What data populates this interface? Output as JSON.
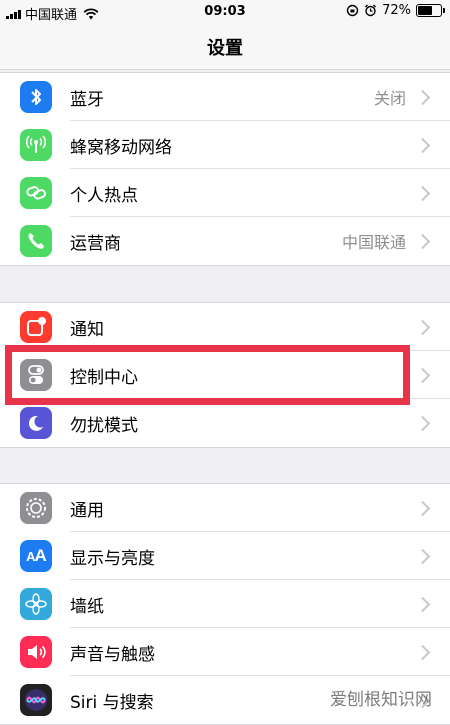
{
  "status_bar": {
    "carrier": "中国联通",
    "time": "09:03",
    "battery_text": "72%",
    "battery_level": 0.72
  },
  "nav": {
    "title": "设置"
  },
  "groups": [
    [
      {
        "label": "蓝牙",
        "value": "关闭",
        "icon": "bluetooth-icon",
        "color": "#1e7cf2"
      },
      {
        "label": "蜂窝移动网络",
        "value": "",
        "icon": "cellular-icon",
        "color": "#4cd964"
      },
      {
        "label": "个人热点",
        "value": "",
        "icon": "hotspot-icon",
        "color": "#4cd964"
      },
      {
        "label": "运营商",
        "value": "中国联通",
        "icon": "phone-icon",
        "color": "#4cd964"
      }
    ],
    [
      {
        "label": "通知",
        "value": "",
        "icon": "notification-icon",
        "color": "#ff3b30"
      },
      {
        "label": "控制中心",
        "value": "",
        "icon": "control-center-icon",
        "color": "#8e8e93"
      },
      {
        "label": "勿扰模式",
        "value": "",
        "icon": "moon-icon",
        "color": "#5856d6"
      }
    ],
    [
      {
        "label": "通用",
        "value": "",
        "icon": "gear-icon",
        "color": "#8e8e93"
      },
      {
        "label": "显示与亮度",
        "value": "",
        "icon": "display-icon",
        "color": "#1e7cf2"
      },
      {
        "label": "墙纸",
        "value": "",
        "icon": "wallpaper-icon",
        "color": "#34aadc"
      },
      {
        "label": "声音与触感",
        "value": "",
        "icon": "sound-icon",
        "color": "#ff2d55"
      },
      {
        "label": "Siri 与搜索",
        "value": "",
        "icon": "siri-icon",
        "color": "#222222"
      }
    ]
  ],
  "watermark": "爱刨根知识网",
  "highlight_color": "#e8344a"
}
